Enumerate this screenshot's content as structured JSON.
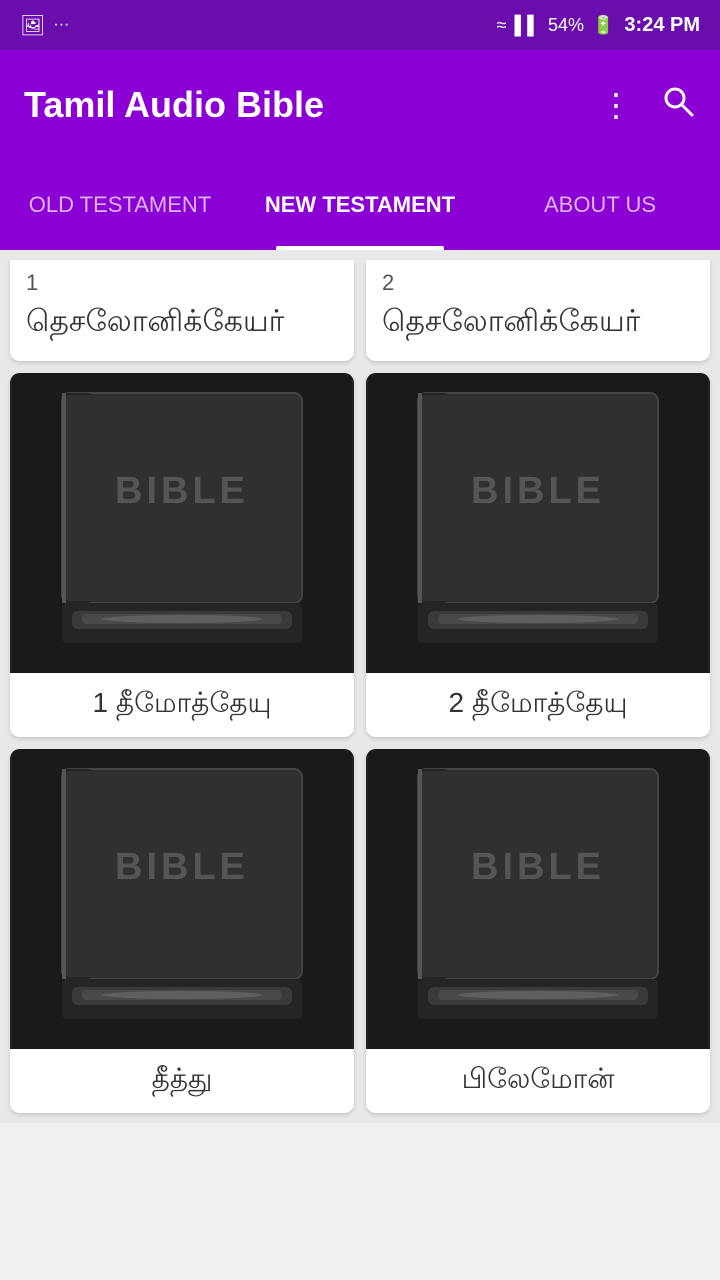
{
  "statusBar": {
    "battery": "54%",
    "time": "3:24 PM"
  },
  "appBar": {
    "title": "Tamil Audio Bible",
    "moreIcon": "⋮",
    "searchIcon": "🔍"
  },
  "tabs": [
    {
      "id": "old-testament",
      "label": "OLD TESTAMENT",
      "active": false
    },
    {
      "id": "new-testament",
      "label": "NEW TESTAMENT",
      "active": true
    },
    {
      "id": "about-us",
      "label": "ABOUT US",
      "active": false
    }
  ],
  "partialCards": [
    {
      "number": "1",
      "title": "தெசலோனிக்கேயர்"
    },
    {
      "number": "2",
      "title": "தெசலோனிக்கேயர்"
    }
  ],
  "cards": [
    {
      "id": "card-1-timothy",
      "label": "1 தீமோத்தேயு",
      "imageAlt": "Bible book"
    },
    {
      "id": "card-2-timothy",
      "label": "2 தீமோத்தேயு",
      "imageAlt": "Bible book"
    },
    {
      "id": "card-titus",
      "label": "தீத்து",
      "imageAlt": "Bible book"
    },
    {
      "id": "card-philemon",
      "label": "பிலேமோன்",
      "imageAlt": "Bible book"
    }
  ]
}
